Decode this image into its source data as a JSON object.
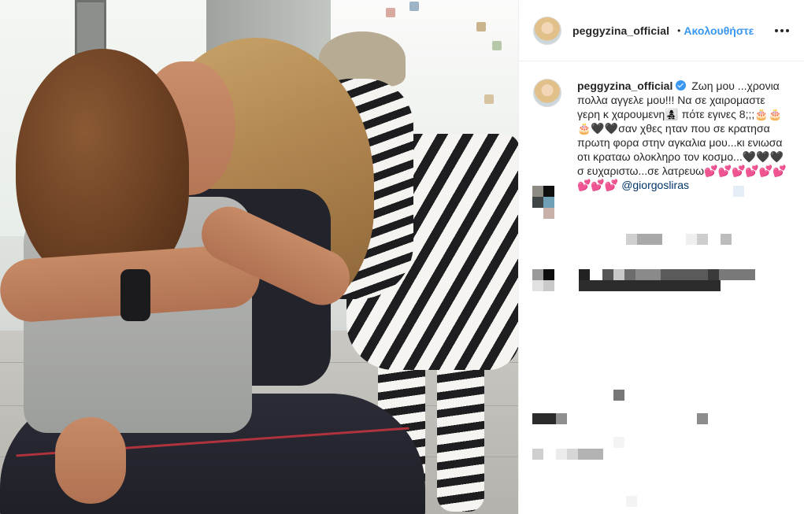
{
  "post": {
    "username": "peggyzina_official",
    "follow_separator": "•",
    "follow_label": "Ακολουθήστε",
    "more_icon": "more-options-icon"
  },
  "caption": {
    "username": "peggyzina_official",
    "verified_icon": "verified-badge-icon",
    "text": "Ζωη μου ...χρονια πολλα αγγελε μου!!! Να σε χαιρομαστε γερη κ χαρουμενη👩‍👧‍👦 πότε εγινες 8;;;🎂🎂🎂🖤🖤σαν χθες ηταν που σε κρατησα πρωτη φορα στην αγκαλια μου...κι ενιωσα οτι κραταω ολοκληρο τον κοσμο...🖤🖤🖤 σ ευχαριστω...σε λατρευω💕💕💕💕💕💕💕💕💕 ",
    "mention": "@giorgosliras"
  },
  "colors": {
    "accent": "#3897f0",
    "text": "#262626",
    "mention": "#003569",
    "border": "#efefef"
  }
}
